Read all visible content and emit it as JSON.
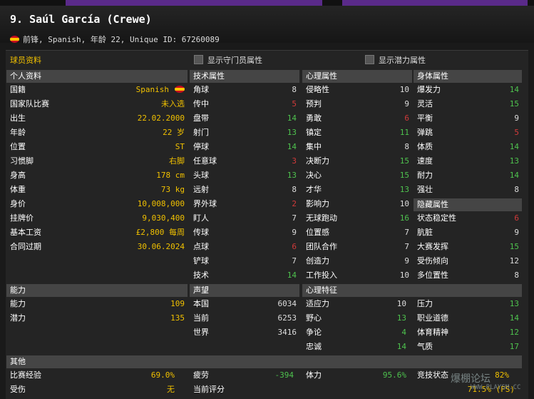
{
  "header": {
    "title": "9. Saúl García (Crewe)",
    "subtitle": "前锋, Spanish, 年龄 22, Unique ID: 67260089"
  },
  "panel": {
    "title": "球员资料",
    "show_gk_attrs": "显示守门员属性",
    "show_potential_attrs": "显示潜力属性"
  },
  "personal": {
    "title": "个人资料",
    "rows": [
      {
        "label": "国籍",
        "value": "Spanish",
        "color": "y",
        "flag": true
      },
      {
        "label": "国家队比赛",
        "value": "未入选",
        "color": "y"
      },
      {
        "label": "出生",
        "value": "22.02.2000",
        "color": "y"
      },
      {
        "label": "年龄",
        "value": "22 岁",
        "color": "y"
      },
      {
        "label": "位置",
        "value": "ST",
        "color": "y"
      },
      {
        "label": "习惯脚",
        "value": "右脚",
        "color": "y"
      },
      {
        "label": "身高",
        "value": "178 cm",
        "color": "y"
      },
      {
        "label": "体重",
        "value": "73 kg",
        "color": "y"
      },
      {
        "label": "身价",
        "value": "10,008,000",
        "color": "y"
      },
      {
        "label": "挂牌价",
        "value": "9,030,400",
        "color": "y"
      },
      {
        "label": "基本工资",
        "value": "£2,800 每周",
        "color": "y"
      },
      {
        "label": "合同过期",
        "value": "30.06.2024",
        "color": "y"
      }
    ]
  },
  "technical": {
    "title": "技术属性",
    "rows": [
      {
        "label": "角球",
        "value": "8",
        "color": "w"
      },
      {
        "label": "传中",
        "value": "5",
        "color": "r"
      },
      {
        "label": "盘带",
        "value": "14",
        "color": "g"
      },
      {
        "label": "射门",
        "value": "13",
        "color": "g"
      },
      {
        "label": "停球",
        "value": "14",
        "color": "g"
      },
      {
        "label": "任意球",
        "value": "3",
        "color": "r"
      },
      {
        "label": "头球",
        "value": "13",
        "color": "g"
      },
      {
        "label": "远射",
        "value": "8",
        "color": "w"
      },
      {
        "label": "界外球",
        "value": "2",
        "color": "r"
      },
      {
        "label": "盯人",
        "value": "7",
        "color": "w"
      },
      {
        "label": "传球",
        "value": "9",
        "color": "w"
      },
      {
        "label": "点球",
        "value": "6",
        "color": "r"
      },
      {
        "label": "铲球",
        "value": "7",
        "color": "w"
      },
      {
        "label": "技术",
        "value": "14",
        "color": "g"
      }
    ]
  },
  "mental": {
    "title": "心理属性",
    "rows": [
      {
        "label": "侵略性",
        "value": "10",
        "color": "w"
      },
      {
        "label": "预判",
        "value": "9",
        "color": "w"
      },
      {
        "label": "勇敢",
        "value": "6",
        "color": "r"
      },
      {
        "label": "镇定",
        "value": "11",
        "color": "g"
      },
      {
        "label": "集中",
        "value": "8",
        "color": "w"
      },
      {
        "label": "决断力",
        "value": "15",
        "color": "g"
      },
      {
        "label": "决心",
        "value": "15",
        "color": "g"
      },
      {
        "label": "才华",
        "value": "13",
        "color": "g"
      },
      {
        "label": "影响力",
        "value": "10",
        "color": "w"
      },
      {
        "label": "无球跑动",
        "value": "16",
        "color": "g"
      },
      {
        "label": "位置感",
        "value": "7",
        "color": "w"
      },
      {
        "label": "团队合作",
        "value": "7",
        "color": "w"
      },
      {
        "label": "创造力",
        "value": "9",
        "color": "w"
      },
      {
        "label": "工作投入",
        "value": "10",
        "color": "w"
      }
    ]
  },
  "physical": {
    "title": "身体属性",
    "rows": [
      {
        "label": "爆发力",
        "value": "14",
        "color": "g"
      },
      {
        "label": "灵活",
        "value": "15",
        "color": "g"
      },
      {
        "label": "平衡",
        "value": "9",
        "color": "w"
      },
      {
        "label": "弹跳",
        "value": "5",
        "color": "r"
      },
      {
        "label": "体质",
        "value": "14",
        "color": "g"
      },
      {
        "label": "速度",
        "value": "13",
        "color": "g"
      },
      {
        "label": "耐力",
        "value": "14",
        "color": "g"
      },
      {
        "label": "强壮",
        "value": "8",
        "color": "w"
      }
    ]
  },
  "hidden": {
    "title": "隐藏属性",
    "rows": [
      {
        "label": "状态稳定性",
        "value": "6",
        "color": "r"
      },
      {
        "label": "肮脏",
        "value": "9",
        "color": "w"
      },
      {
        "label": "大赛发挥",
        "value": "15",
        "color": "g"
      },
      {
        "label": "受伤倾向",
        "value": "12",
        "color": "w"
      },
      {
        "label": "多位置性",
        "value": "8",
        "color": "w"
      }
    ]
  },
  "ability": {
    "title": "能力",
    "rows": [
      {
        "label": "能力",
        "value": "109",
        "color": "y"
      },
      {
        "label": "潜力",
        "value": "135",
        "color": "y"
      }
    ]
  },
  "reputation": {
    "title": "声望",
    "rows": [
      {
        "label": "本国",
        "value": "6034",
        "color": "w"
      },
      {
        "label": "当前",
        "value": "6253",
        "color": "w"
      },
      {
        "label": "世界",
        "value": "3416",
        "color": "w"
      }
    ]
  },
  "traits": {
    "title": "心理特征",
    "rows": [
      {
        "label": "适应力",
        "value": "10",
        "color": "w"
      },
      {
        "label": "压力",
        "value": "13",
        "color": "g"
      },
      {
        "label": "野心",
        "value": "13",
        "color": "g"
      },
      {
        "label": "职业道德",
        "value": "14",
        "color": "g"
      },
      {
        "label": "争论",
        "value": "4",
        "color": "g"
      },
      {
        "label": "体育精神",
        "value": "12",
        "color": "g"
      },
      {
        "label": "忠诚",
        "value": "14",
        "color": "g"
      },
      {
        "label": "气质",
        "value": "17",
        "color": "g"
      }
    ]
  },
  "other": {
    "title": "其他",
    "rows": [
      {
        "label": "比赛经验",
        "value": "69.0%",
        "color": "y"
      },
      {
        "label": "疲劳",
        "value": "-394",
        "color": "g"
      },
      {
        "label": "体力",
        "value": "95.6%",
        "color": "g"
      },
      {
        "label": "竞技状态",
        "value": "82%",
        "color": "y"
      },
      {
        "label": "受伤",
        "value": "无",
        "color": "y"
      },
      {
        "label": "当前评分",
        "value": "71.5% (FS)",
        "color": "y"
      }
    ]
  },
  "watermark": {
    "text": "爆棚论坛",
    "url": "WWW.PLAYSM.CC"
  },
  "colors": {
    "tab_accent": "#5a2a8a",
    "gold": "#f0c000",
    "green": "#4ec24e",
    "red": "#d23a3a"
  }
}
